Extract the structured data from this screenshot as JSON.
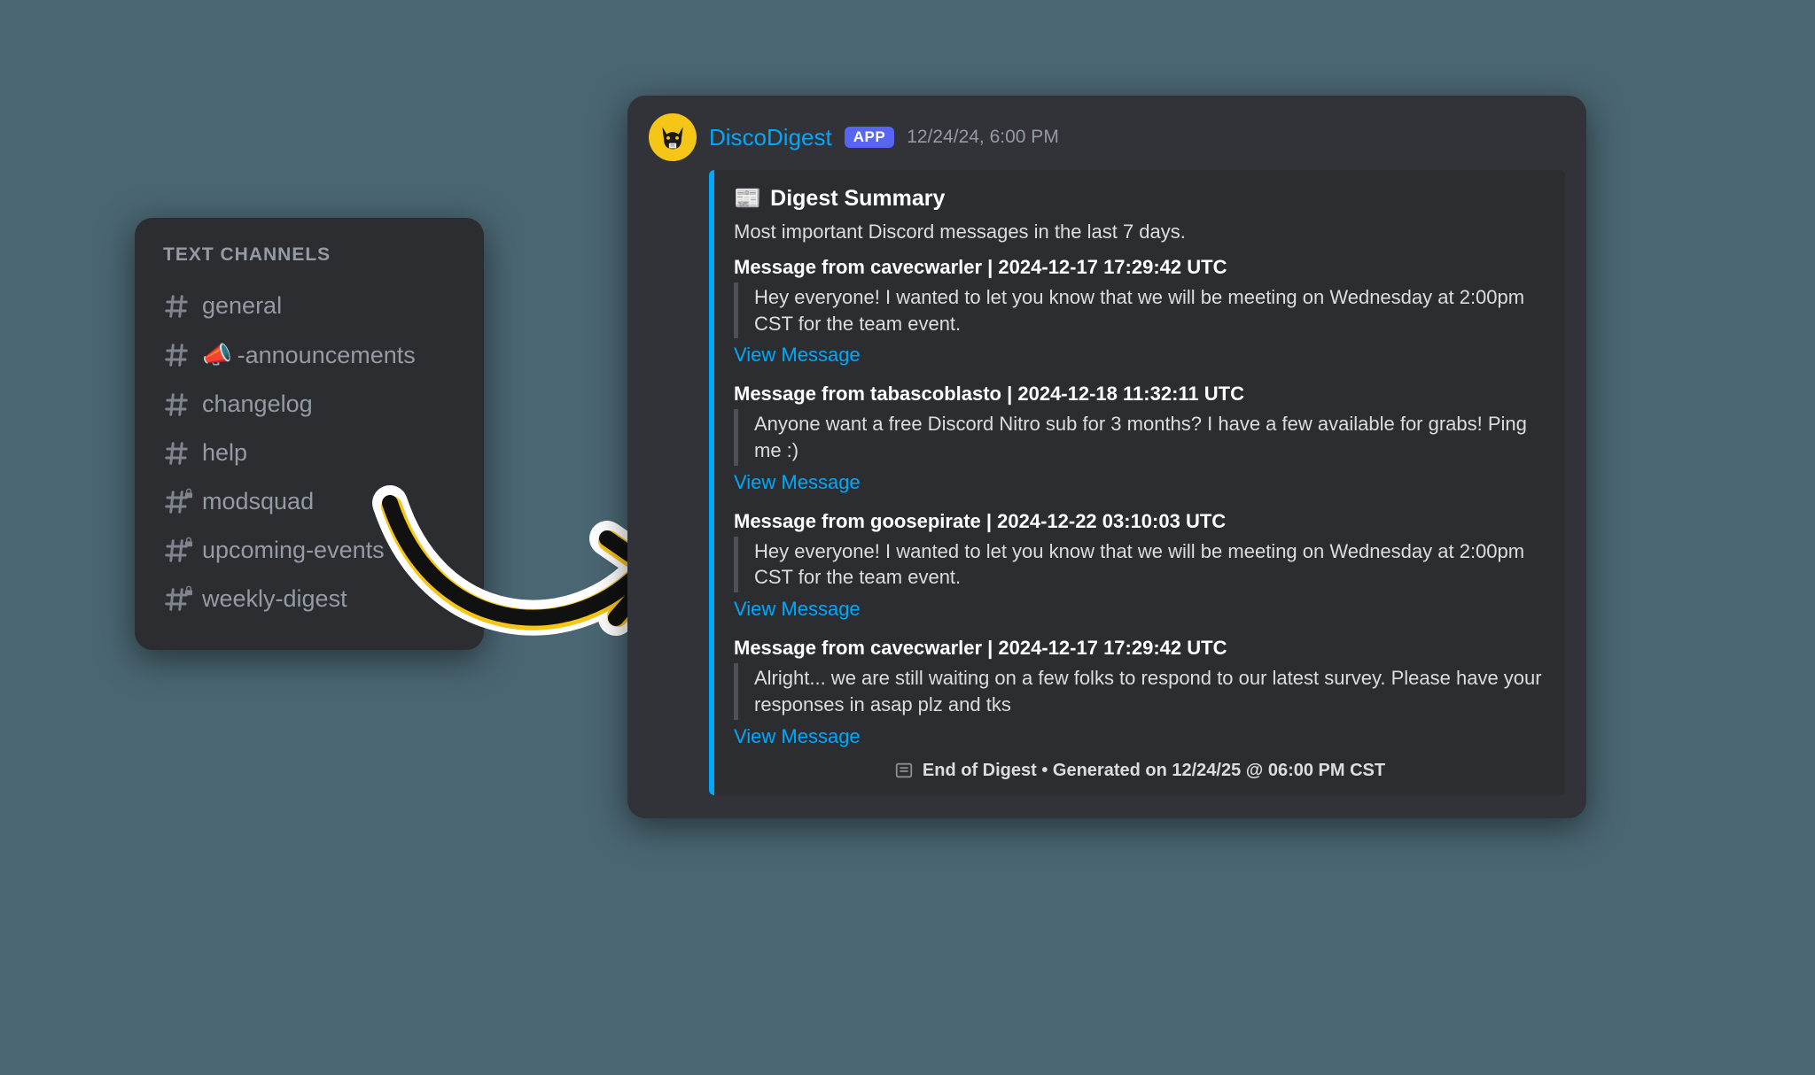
{
  "sidebar": {
    "header": "TEXT CHANNELS",
    "channels": [
      {
        "name": "general",
        "locked": false,
        "emoji": ""
      },
      {
        "name": "-announcements",
        "locked": false,
        "emoji": "📣"
      },
      {
        "name": "changelog",
        "locked": false,
        "emoji": ""
      },
      {
        "name": "help",
        "locked": false,
        "emoji": ""
      },
      {
        "name": "modsquad",
        "locked": true,
        "emoji": ""
      },
      {
        "name": "upcoming-events",
        "locked": true,
        "emoji": ""
      },
      {
        "name": "weekly-digest",
        "locked": true,
        "emoji": ""
      }
    ]
  },
  "message": {
    "bot_name": "DiscoDigest",
    "app_badge": "APP",
    "timestamp": "12/24/24, 6:00 PM",
    "embed": {
      "title_icon": "📰",
      "title": "Digest Summary",
      "subtitle": "Most important Discord messages in the last 7 days.",
      "items": [
        {
          "head": "Message from cavecwarler | 2024-12-17 17:29:42 UTC",
          "body": "Hey everyone! I wanted to let you know that we will be meeting on Wednesday at 2:00pm CST for the team event.",
          "link": "View Message"
        },
        {
          "head": "Message from tabascoblasto | 2024-12-18 11:32:11 UTC",
          "body": "Anyone want a free Discord Nitro sub for 3 months? I have a few available for grabs! Ping me :)",
          "link": "View Message"
        },
        {
          "head": "Message from goosepirate | 2024-12-22 03:10:03 UTC",
          "body": "Hey everyone! I wanted to let you know that we will be meeting on Wednesday at 2:00pm CST for the team event.",
          "link": "View Message"
        },
        {
          "head": "Message from cavecwarler | 2024-12-17 17:29:42 UTC",
          "body": "Alright... we are still waiting on a few folks to respond to our latest survey. Please have your responses in asap plz and tks",
          "link": "View Message"
        }
      ],
      "footer": "End of Digest • Generated on 12/24/25 @ 06:00 PM CST"
    }
  }
}
